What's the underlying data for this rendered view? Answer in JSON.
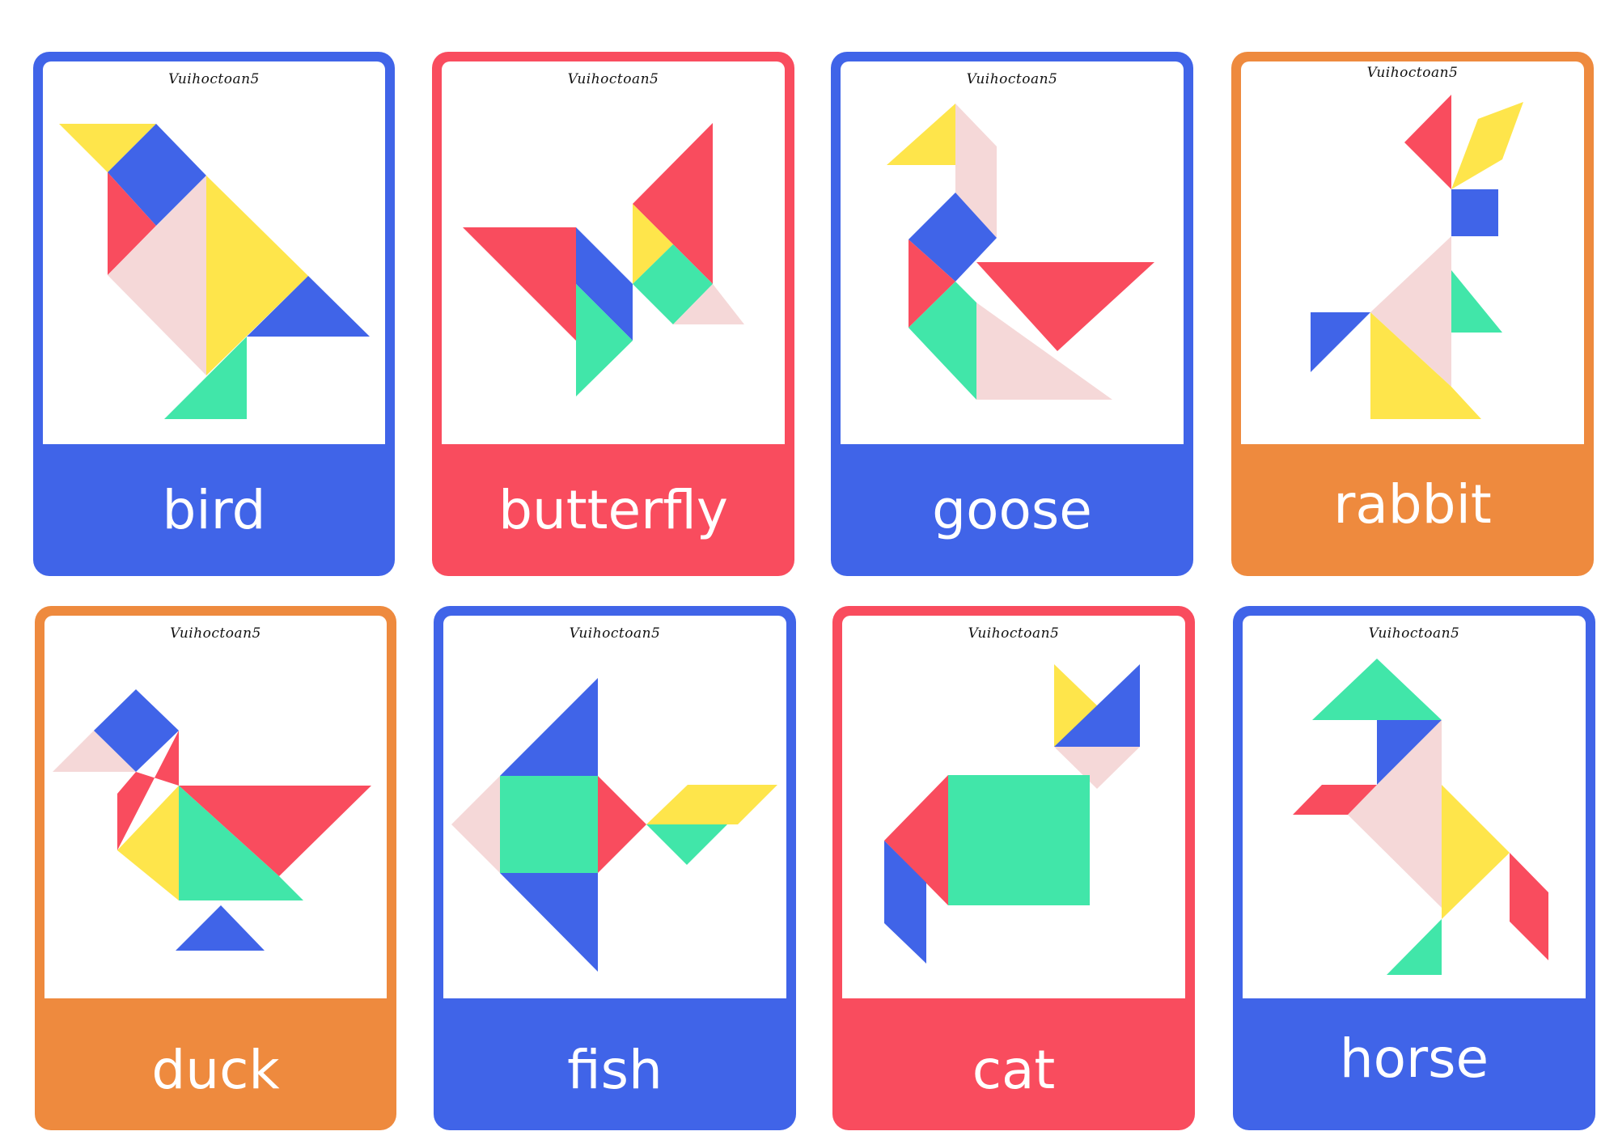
{
  "colors": {
    "blue": "#4064E8",
    "red": "#F94C5E",
    "orange": "#EE8A3E",
    "yellow": "#FEE54B",
    "green": "#41E6A9",
    "pink": "#F5D8D8"
  },
  "watermark": "Vuihoctoan5",
  "cards": [
    {
      "label": "bird",
      "frame_color": "blue"
    },
    {
      "label": "butterfly",
      "frame_color": "red"
    },
    {
      "label": "goose",
      "frame_color": "blue"
    },
    {
      "label": "rabbit",
      "frame_color": "orange"
    },
    {
      "label": "duck",
      "frame_color": "orange"
    },
    {
      "label": "fish",
      "frame_color": "blue"
    },
    {
      "label": "cat",
      "frame_color": "red"
    },
    {
      "label": "horse",
      "frame_color": "blue"
    }
  ]
}
